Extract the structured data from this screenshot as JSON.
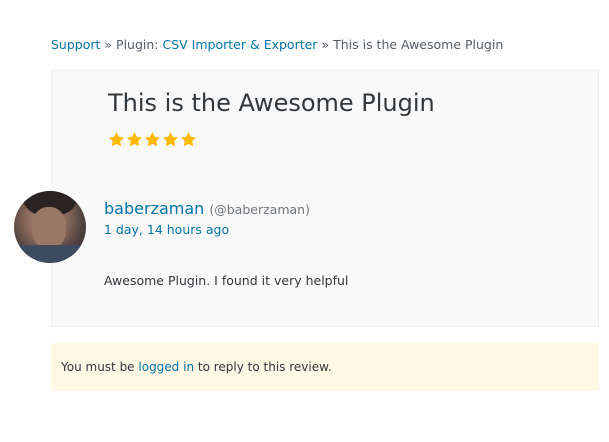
{
  "breadcrumb": {
    "support": "Support",
    "separator": "»",
    "plugin_prefix": "Plugin: ",
    "plugin_name": "CSV Importer & Exporter",
    "current": "This is the Awesome Plugin"
  },
  "review": {
    "title": "This is the Awesome Plugin",
    "rating": 5,
    "rating_max": 5,
    "star_color": "#ffb900"
  },
  "author": {
    "name": "baberzaman",
    "handle": "(@baberzaman)",
    "time_ago": "1 day, 14 hours ago"
  },
  "body": "Awesome Plugin. I found it very helpful",
  "notice": {
    "prefix": "You must be ",
    "link": "logged in",
    "suffix": " to reply to this review."
  },
  "colors": {
    "link": "#0073aa",
    "notice_bg": "#fff8e5",
    "box_bg": "#f9f9f9"
  }
}
